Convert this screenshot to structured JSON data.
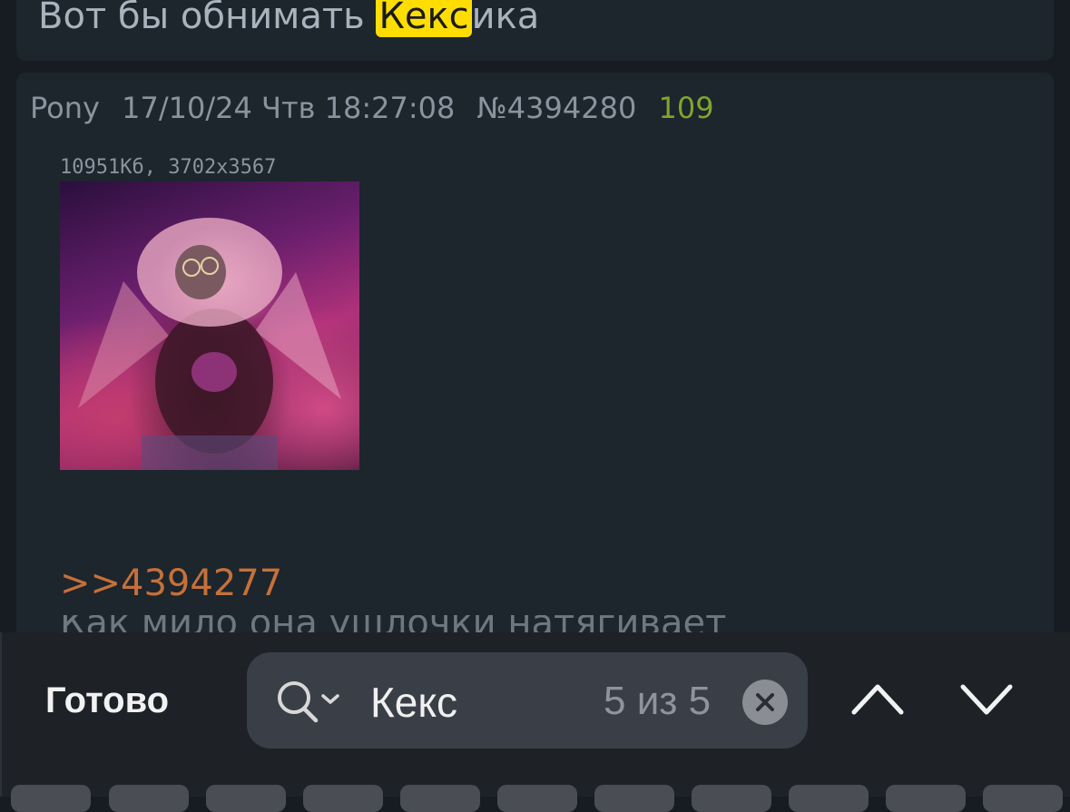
{
  "prev_post": {
    "text_before": "Вот бы обнимать ",
    "text_highlight": "Кекс",
    "text_after": "ика"
  },
  "post": {
    "author": "Pony",
    "datetime": "17/10/24 Чтв 18:27:08",
    "number": "№4394280",
    "replies": "109",
    "file_info": "10951Кб, 3702x3567",
    "reply_link": ">>4394277",
    "body_partial": "Как мило она ушлочки натягивает"
  },
  "find_bar": {
    "done_label": "Готово",
    "search_value": "Кекс",
    "match_count": "5 из 5",
    "icons": {
      "search": "search-icon",
      "clear": "clear-icon",
      "prev": "chevron-up-icon",
      "next": "chevron-down-icon"
    }
  },
  "colors": {
    "highlight": "#ffdd00",
    "reply_count": "#7fa52d",
    "reply_link": "#c4713a",
    "card": "#1d252d"
  }
}
